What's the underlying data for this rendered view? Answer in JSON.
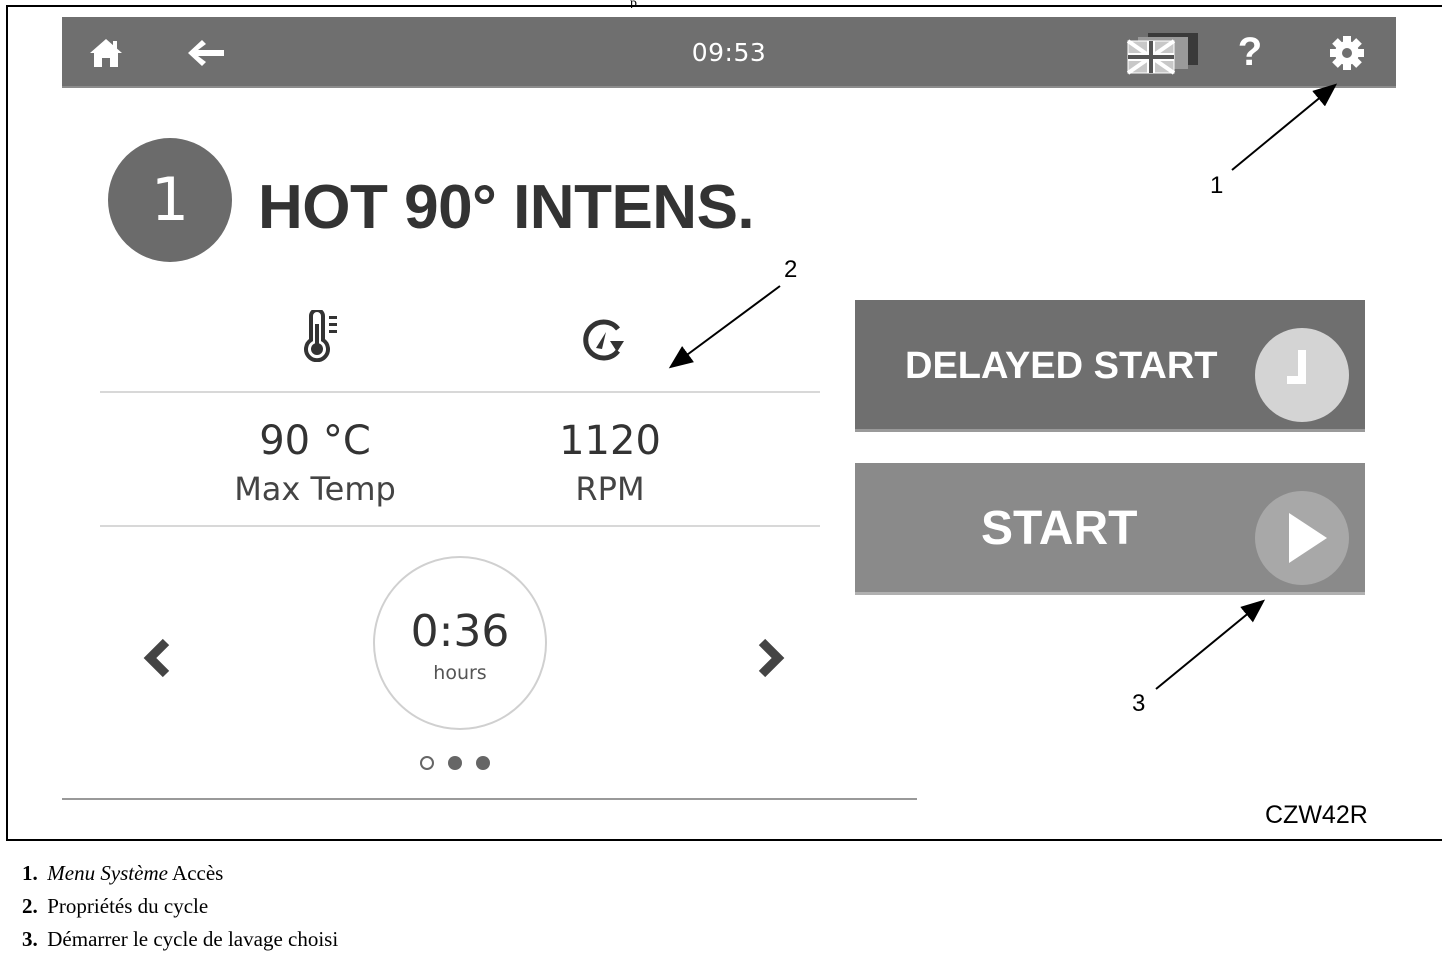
{
  "header_fragment": "p",
  "topbar": {
    "time": "09:53",
    "icons": [
      "home-icon",
      "back-arrow-icon",
      "language-flag-icon",
      "help-icon",
      "settings-gear-icon"
    ]
  },
  "program": {
    "number": "1",
    "title": "HOT 90° INTENS."
  },
  "stats": {
    "temperature": {
      "value": "90 °C",
      "label": "Max Temp"
    },
    "spin": {
      "value": "1120",
      "label": "RPM"
    }
  },
  "duration": {
    "value": "0:36",
    "unit": "hours"
  },
  "pagination": {
    "total": 3,
    "active": 0
  },
  "buttons": {
    "delayed_start": "DELAYED START",
    "start": "START"
  },
  "callouts": {
    "c1": "1",
    "c2": "2",
    "c3": "3"
  },
  "figure_code": "CZW42R",
  "legend": [
    {
      "num": "1.",
      "italic": "Menu Système",
      "text": " Accès"
    },
    {
      "num": "2.",
      "italic": "",
      "text": "Propriétés du cycle"
    },
    {
      "num": "3.",
      "italic": "",
      "text": "Démarrer le cycle de lavage choisi"
    }
  ],
  "colors": {
    "bar": "#6f6f6f",
    "delayed_button": "#6f6f6f",
    "start_button": "#8a8a8a",
    "program_circle": "#6b6b6b"
  }
}
